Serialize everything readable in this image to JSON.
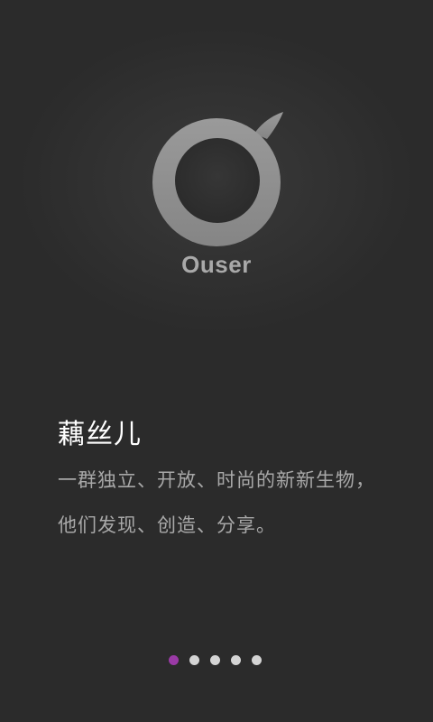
{
  "app": {
    "name": "Ouser",
    "logo_icon": "ouser-logo-icon"
  },
  "intro": {
    "headline": "藕丝儿",
    "description_lines": [
      "一群独立、开放、时尚的新新生物，",
      "他们发现、创造、分享。"
    ]
  },
  "pager": {
    "total": 5,
    "active_index": 0,
    "active_color": "#9a3aa6",
    "inactive_color": "#d4d4d4"
  },
  "colors": {
    "background": "#2b2b2b",
    "logo_ring": "#8f8f8f",
    "logo_inner": "#2f2f2f"
  }
}
